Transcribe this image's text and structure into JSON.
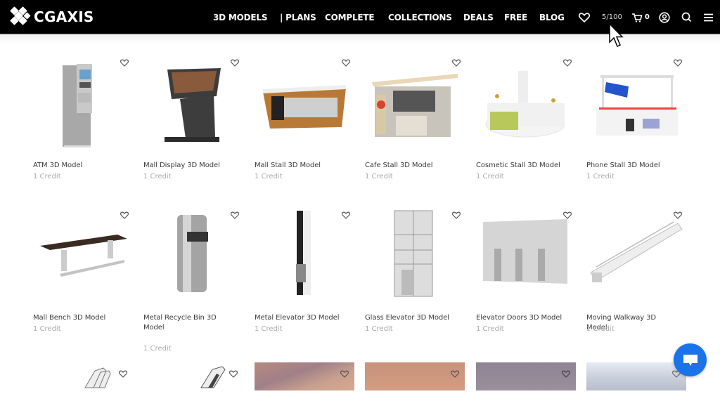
{
  "brand": {
    "name": "CGAXIS"
  },
  "nav": {
    "items": [
      {
        "label": "3D MODELS",
        "dropdown": true
      },
      {
        "label": "| PLANS",
        "dropdown": false
      },
      {
        "label": "COMPLETE",
        "dropdown": true
      },
      {
        "label": "COLLECTIONS",
        "dropdown": true
      },
      {
        "label": "DEALS",
        "dropdown": false
      },
      {
        "label": "FREE",
        "dropdown": false
      },
      {
        "label": "BLOG",
        "dropdown": false
      }
    ],
    "icons": [
      "heart-icon",
      "cart-icon",
      "user-account-icon",
      "search-icon",
      "hamburger-menu-icon"
    ],
    "downloads_counter": "5/100",
    "cart_count": "0"
  },
  "products": [
    {
      "title": "ATM 3D Model",
      "price": "1 Credit"
    },
    {
      "title": "Mall Display 3D Model",
      "price": "1 Credit"
    },
    {
      "title": "Mall Stall 3D Model",
      "price": "1 Credit"
    },
    {
      "title": "Cafe Stall 3D Model",
      "price": "1 Credit"
    },
    {
      "title": "Cosmetic Stall 3D Model",
      "price": "1 Credit"
    },
    {
      "title": "Phone Stall 3D Model",
      "price": "1 Credit"
    },
    {
      "title": "Mall Bench 3D Model",
      "price": "1 Credit"
    },
    {
      "title": "Metal Recycle Bin 3D Model",
      "price": "1 Credit"
    },
    {
      "title": "Metal Elevator 3D Model",
      "price": "1 Credit"
    },
    {
      "title": "Glass Elevator 3D Model",
      "price": "1 Credit"
    },
    {
      "title": "Elevator Doors 3D Model",
      "price": "1 Credit"
    },
    {
      "title": "Moving Walkway 3D Model",
      "price": "1 Credit"
    }
  ],
  "partial_row": [
    "escalator-render",
    "escalator-render",
    "sky-photo-pink",
    "sky-photo-peach",
    "sky-photo-purple",
    "sky-photo-clouds"
  ],
  "colors": {
    "nav_bg": "#000000",
    "chat_button": "#1a73e8",
    "title_text": "#3a3a3a",
    "price_text": "#aaaaaa"
  },
  "chat": {
    "icon": "chat-bubble-icon"
  }
}
